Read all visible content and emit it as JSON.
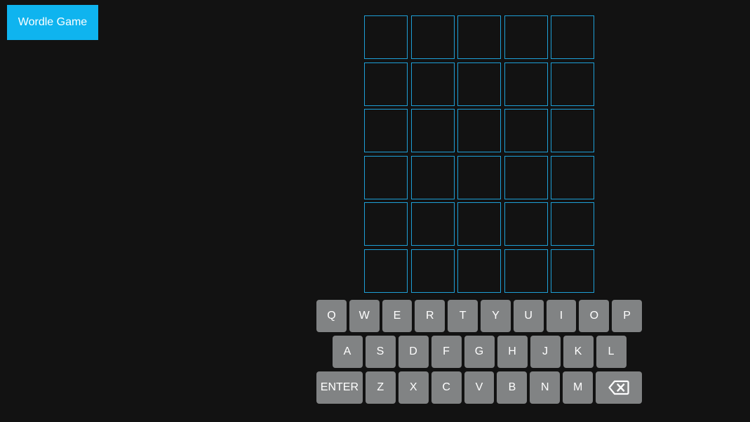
{
  "header": {
    "title": "Wordle Game"
  },
  "board": {
    "rows": [
      [
        "",
        "",
        "",
        "",
        ""
      ],
      [
        "",
        "",
        "",
        "",
        ""
      ],
      [
        "",
        "",
        "",
        "",
        ""
      ],
      [
        "",
        "",
        "",
        "",
        ""
      ],
      [
        "",
        "",
        "",
        "",
        ""
      ],
      [
        "",
        "",
        "",
        "",
        ""
      ]
    ]
  },
  "keyboard": {
    "row1": [
      "Q",
      "W",
      "E",
      "R",
      "T",
      "Y",
      "U",
      "I",
      "O",
      "P"
    ],
    "row2": [
      "A",
      "S",
      "D",
      "F",
      "G",
      "H",
      "J",
      "K",
      "L"
    ],
    "row3": [
      "ENTER",
      "Z",
      "X",
      "C",
      "V",
      "B",
      "N",
      "M"
    ],
    "backspace_icon": "backspace-icon"
  },
  "colors": {
    "accent": "#0fb4ef",
    "tile_border": "#1e9fd6",
    "key_bg": "#818384",
    "background": "#121212"
  }
}
